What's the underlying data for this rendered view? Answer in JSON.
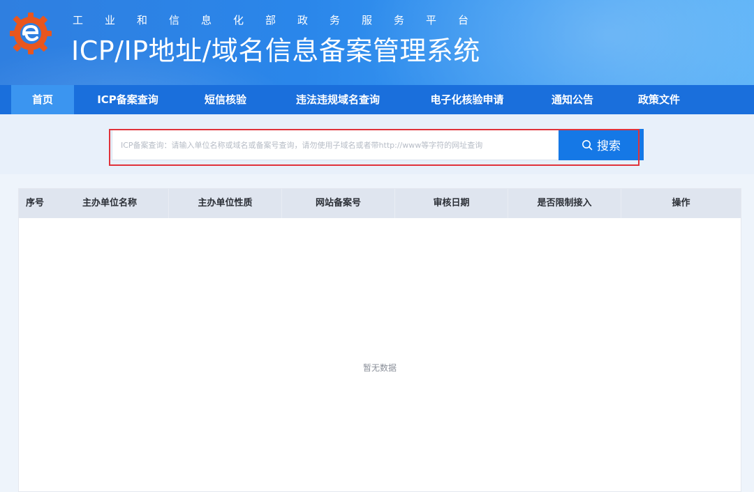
{
  "header": {
    "subtitle": "工业和信息化部政务服务平台",
    "title": "ICP/IP地址/域名信息备案管理系统",
    "logo_icon": "gear-e-logo-icon"
  },
  "nav": {
    "items": [
      {
        "label": "首页",
        "active": true
      },
      {
        "label": "ICP备案查询"
      },
      {
        "label": "短信核验"
      },
      {
        "label": "违法违规域名查询"
      },
      {
        "label": "电子化核验申请"
      },
      {
        "label": "通知公告"
      },
      {
        "label": "政策文件"
      }
    ]
  },
  "search": {
    "placeholder": "ICP备案查询：请输入单位名称或域名或备案号查询，请勿使用子域名或者带http://www等字符的网址查询",
    "button_label": "搜索",
    "button_icon": "search-icon"
  },
  "table": {
    "columns": [
      "序号",
      "主办单位名称",
      "主办单位性质",
      "网站备案号",
      "审核日期",
      "是否限制接入",
      "操作"
    ],
    "empty_text": "暂无数据"
  },
  "colors": {
    "nav_bg": "#1a6fdc",
    "nav_active": "#3b95f0",
    "search_button": "#1578e6",
    "highlight": "#e0323a"
  }
}
